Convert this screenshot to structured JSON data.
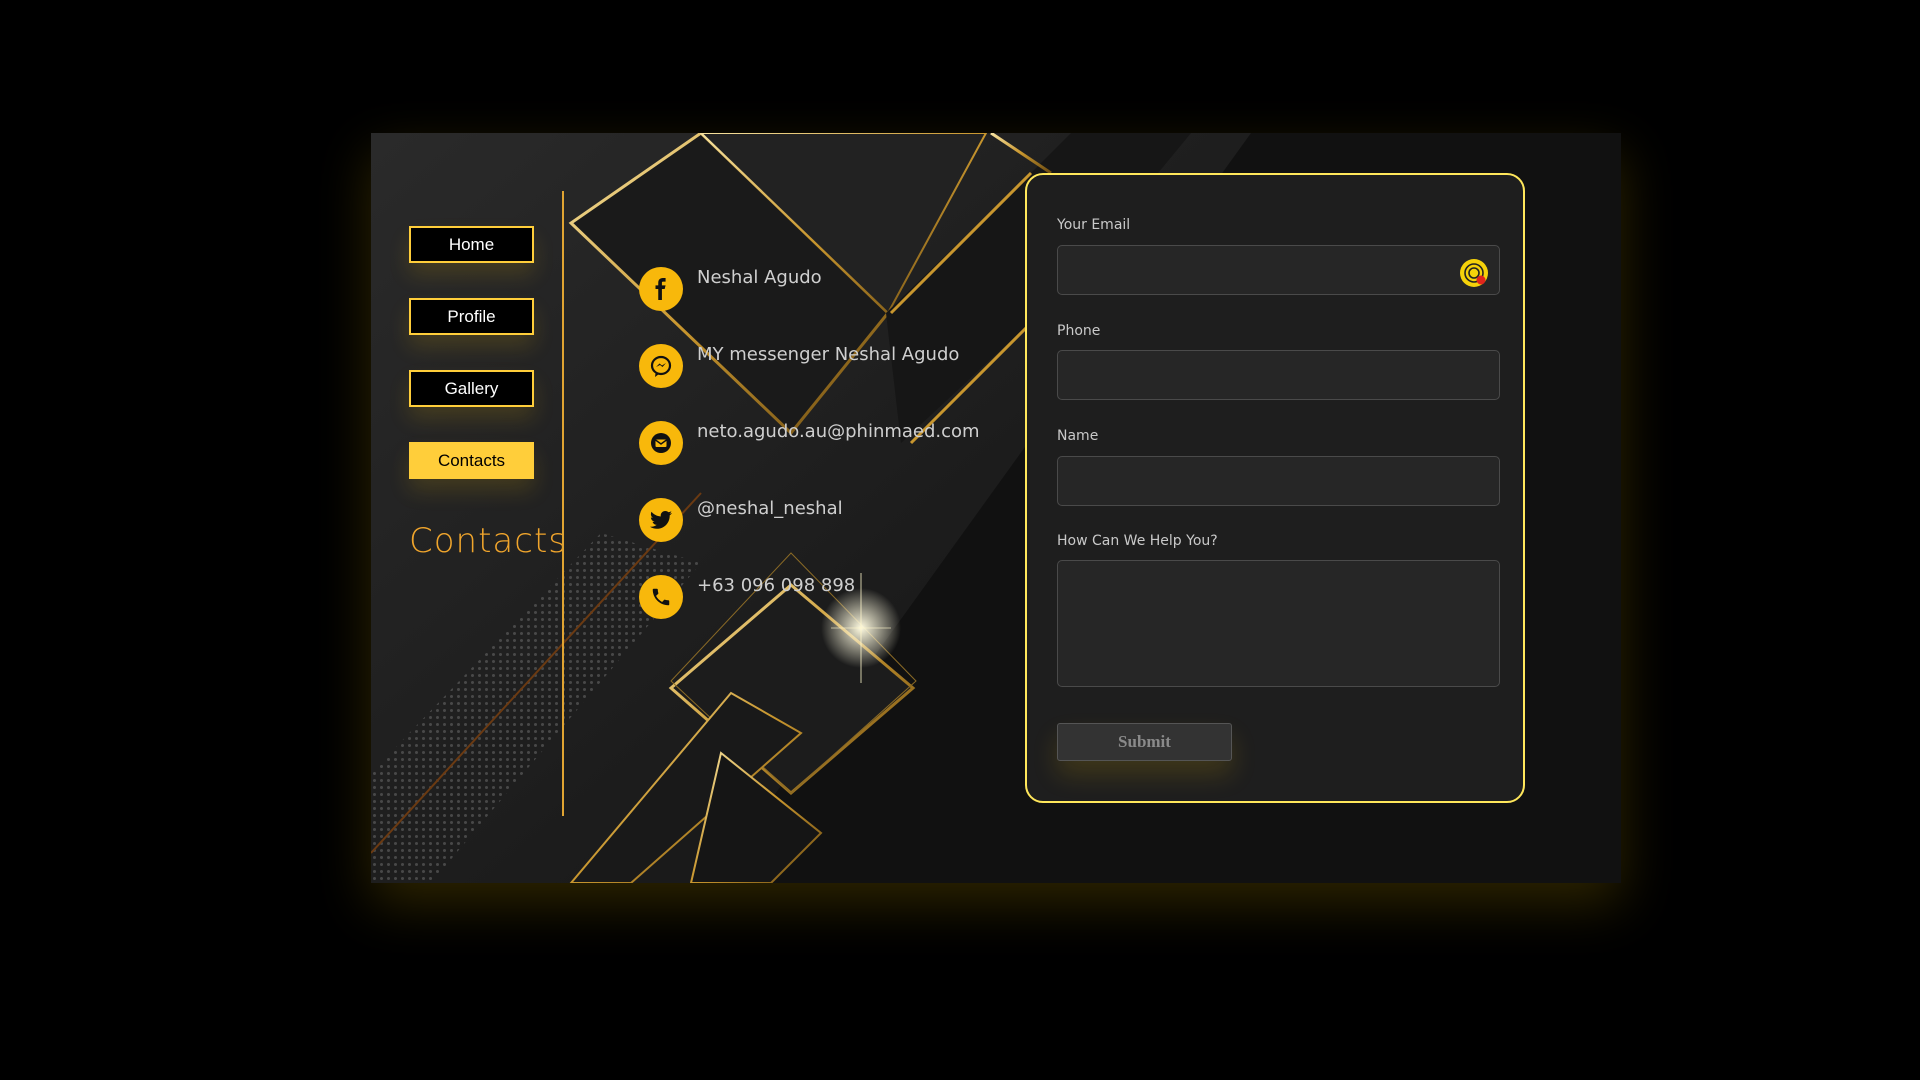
{
  "nav": {
    "items": [
      {
        "label": "Home"
      },
      {
        "label": "Profile"
      },
      {
        "label": "Gallery"
      },
      {
        "label": "Contacts"
      }
    ],
    "active_index": 3
  },
  "side_title": "Contacts",
  "contacts": [
    {
      "icon": "facebook-icon",
      "text": "Neshal Agudo"
    },
    {
      "icon": "messenger-icon",
      "text": "MY messenger Neshal Agudo"
    },
    {
      "icon": "email-icon",
      "text": "neto.agudo.au@phinmaed.com"
    },
    {
      "icon": "twitter-icon",
      "text": "@neshal_neshal"
    },
    {
      "icon": "phone-icon",
      "text": "+63 096 098 898"
    }
  ],
  "form": {
    "email_label": "Your Email",
    "email_value": "",
    "phone_label": "Phone",
    "phone_value": "",
    "name_label": "Name",
    "name_value": "",
    "message_label": "How Can We Help You?",
    "message_value": "",
    "submit_label": "Submit"
  },
  "colors": {
    "accent": "#ffce3a",
    "icon_circle": "#f8b80b",
    "side_title": "#f0a52c",
    "form_border": "#ffe75b",
    "background": "#000000"
  }
}
